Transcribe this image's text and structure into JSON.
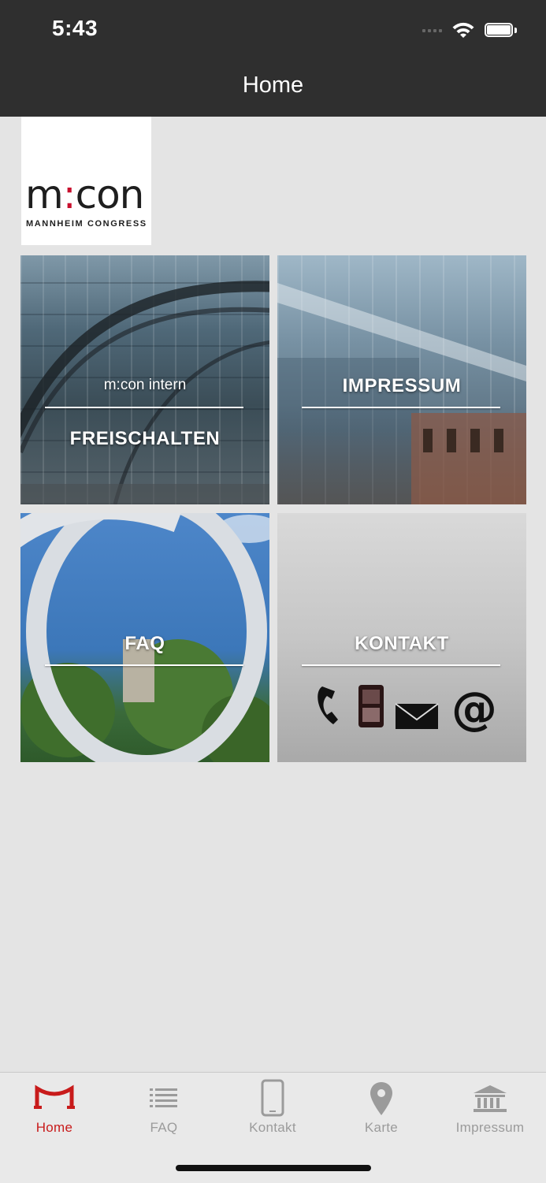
{
  "status": {
    "time": "5:43"
  },
  "nav": {
    "title": "Home"
  },
  "logo": {
    "word_left": "m",
    "word_colon": ":",
    "word_right": "con",
    "subtitle": "MANNHEIM CONGRESS"
  },
  "tiles": [
    {
      "id": "intern",
      "sublabel": "m:con intern",
      "label": "FREISCHALTEN"
    },
    {
      "id": "impressum",
      "label": "IMPRESSUM"
    },
    {
      "id": "faq",
      "label": "FAQ"
    },
    {
      "id": "kontakt",
      "label": "KONTAKT"
    }
  ],
  "tabbar": {
    "items": [
      {
        "label": "Home",
        "icon": "m-logo-icon",
        "active": true
      },
      {
        "label": "FAQ",
        "icon": "list-icon",
        "active": false
      },
      {
        "label": "Kontakt",
        "icon": "phone-icon",
        "active": false
      },
      {
        "label": "Karte",
        "icon": "map-pin-icon",
        "active": false
      },
      {
        "label": "Impressum",
        "icon": "bank-icon",
        "active": false
      }
    ]
  },
  "colors": {
    "accent": "#c81b1b",
    "navbar": "#2f2f2f",
    "background": "#e4e4e4",
    "inactive_tab": "#9b9b9b"
  }
}
